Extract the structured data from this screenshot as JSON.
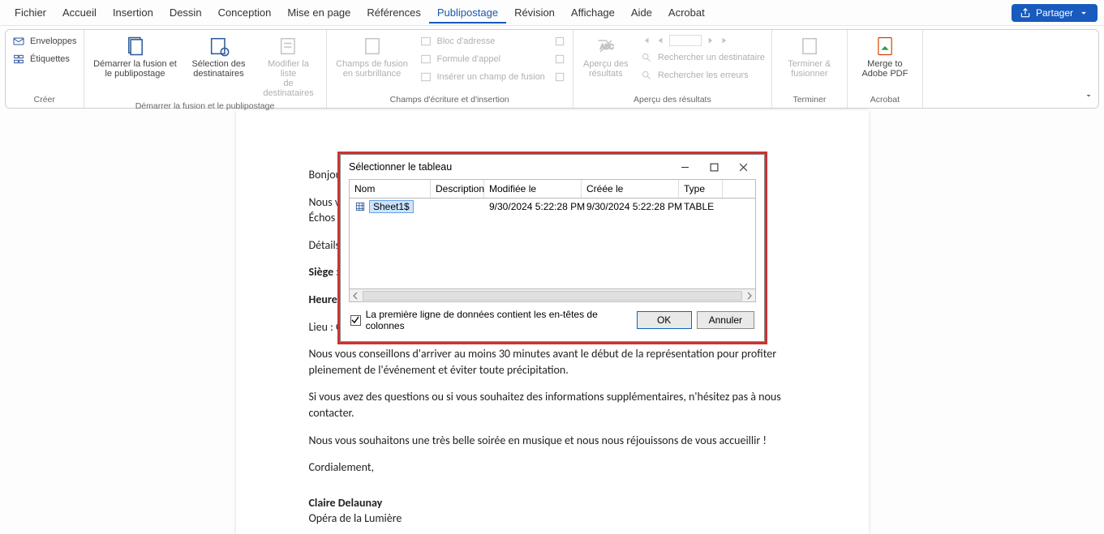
{
  "menu": {
    "items": [
      "Fichier",
      "Accueil",
      "Insertion",
      "Dessin",
      "Conception",
      "Mise en page",
      "Références",
      "Publipostage",
      "Révision",
      "Affichage",
      "Aide",
      "Acrobat"
    ],
    "active_index": 7,
    "share_label": "Partager"
  },
  "ribbon": {
    "group_creer": {
      "label": "Créer",
      "envelopes": "Enveloppes",
      "labels": "Étiquettes"
    },
    "group_start": {
      "label": "Démarrer la fusion et le publipostage",
      "start": "Démarrer la fusion et\nle publipostage",
      "select": "Sélection des\ndestinataires",
      "edit": "Modifier la liste\nde destinataires"
    },
    "group_fields": {
      "label": "Champs d'écriture et d'insertion",
      "highlight": "Champs de fusion\nen surbrillance",
      "block": "Bloc d'adresse",
      "greeting": "Formule d'appel",
      "insert": "Insérer un champ de fusion"
    },
    "group_preview": {
      "label": "Aperçu des résultats",
      "preview": "Aperçu des\nrésultats",
      "find": "Rechercher un destinataire",
      "check": "Rechercher les erreurs"
    },
    "group_finish": {
      "label": "Terminer",
      "finish": "Terminer &\nfusionner"
    },
    "group_acrobat": {
      "label": "Acrobat",
      "merge": "Merge to\nAdobe PDF"
    }
  },
  "document": {
    "p1": "Bonjour",
    "p2": "Nous vo",
    "p3": "Échos d",
    "p4": "Détails d",
    "p5_label": "Siège :",
    "p5_rest": " [",
    "p6_label": "Heure d",
    "p7": "Lieu : O",
    "p8": "Nous vous conseillons d'arriver au moins 30 minutes avant le début de la représentation pour profiter pleinement de l'événement et éviter toute précipitation.",
    "p9": "Si vous avez des questions ou si vous souhaitez des informations supplémentaires, n'hésitez pas à nous contacter.",
    "p10": "Nous vous souhaitons une très belle soirée en musique et nous nous réjouissons de vous accueillir !",
    "p11": "Cordialement,",
    "signature_name": "Claire Delaunay",
    "signature_org": "Opéra de la Lumière"
  },
  "dialog": {
    "title": "Sélectionner le tableau",
    "columns": {
      "name": "Nom",
      "desc": "Description",
      "mod": "Modifiée le",
      "crt": "Créée le",
      "type": "Type"
    },
    "row": {
      "name": "Sheet1$",
      "desc": "",
      "mod": "9/30/2024 5:22:28 PM",
      "crt": "9/30/2024 5:22:28 PM",
      "type": "TABLE"
    },
    "checkbox_label": "La première ligne de données contient les en-têtes de colonnes",
    "checkbox_checked": true,
    "ok": "OK",
    "cancel": "Annuler"
  }
}
